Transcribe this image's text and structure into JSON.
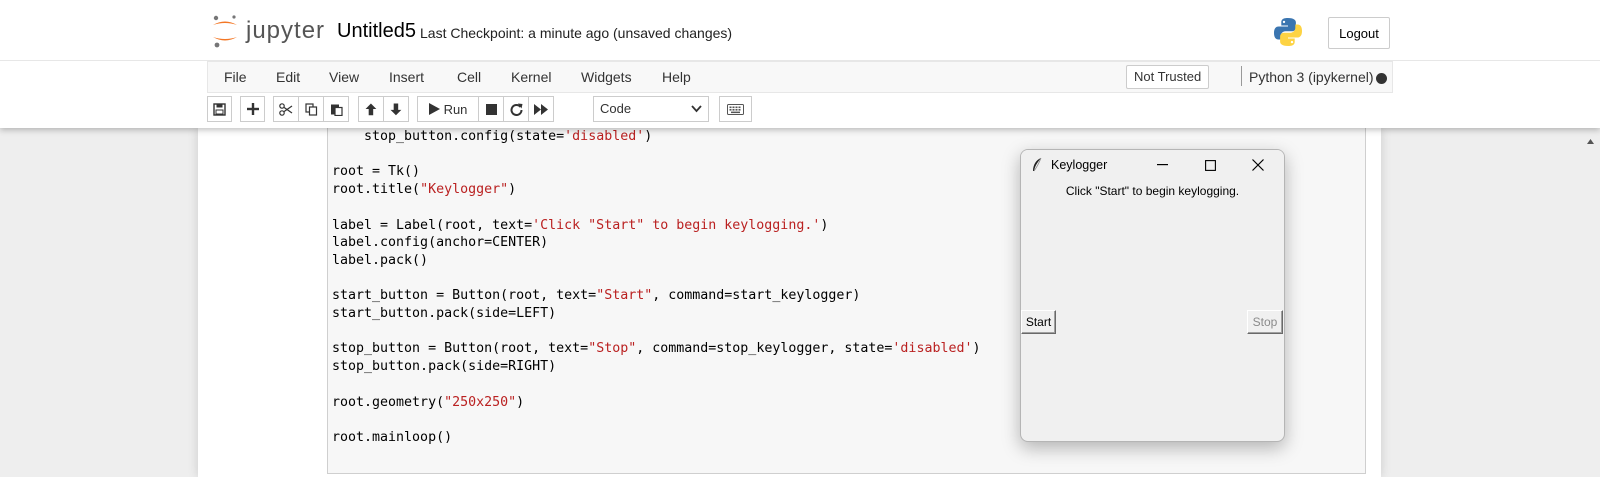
{
  "header": {
    "logo_text": "jupyter",
    "notebook_name": "Untitled5",
    "checkpoint": "Last Checkpoint: a minute ago",
    "autosave_status": "(unsaved changes)",
    "logout_label": "Logout"
  },
  "menubar": {
    "items": [
      "File",
      "Edit",
      "View",
      "Insert",
      "Cell",
      "Kernel",
      "Widgets",
      "Help"
    ],
    "trust_status": "Not Trusted",
    "kernel_name": "Python 3 (ipykernel)"
  },
  "toolbar": {
    "run_label": "Run",
    "cell_type_selected": "Code",
    "icons": [
      "save-icon",
      "plus-icon",
      "scissors-icon",
      "copy-icon",
      "paste-icon",
      "arrow-up-icon",
      "arrow-down-icon",
      "run-icon",
      "stop-icon",
      "restart-icon",
      "fast-forward-icon",
      "keyboard-icon"
    ]
  },
  "code_cell": {
    "lines": [
      "    stop_button.config(state='disabled')",
      "",
      "root = Tk()",
      "root.title(\"Keylogger\")",
      "",
      "label = Label(root, text='Click \"Start\" to begin keylogging.')",
      "label.config(anchor=CENTER)",
      "label.pack()",
      "",
      "start_button = Button(root, text=\"Start\", command=start_keylogger)",
      "start_button.pack(side=LEFT)",
      "",
      "stop_button = Button(root, text=\"Stop\", command=stop_keylogger, state='disabled')",
      "stop_button.pack(side=RIGHT)",
      "",
      "root.geometry(\"250x250\")",
      "",
      "root.mainloop()"
    ]
  },
  "tk_window": {
    "title": "Keylogger",
    "label": "Click \"Start\" to begin keylogging.",
    "start_label": "Start",
    "stop_label": "Stop",
    "stop_state": "disabled"
  },
  "colors": {
    "jupyter_orange": "#f37726",
    "string": "#ba2121",
    "keyword": "#aa22ff"
  }
}
